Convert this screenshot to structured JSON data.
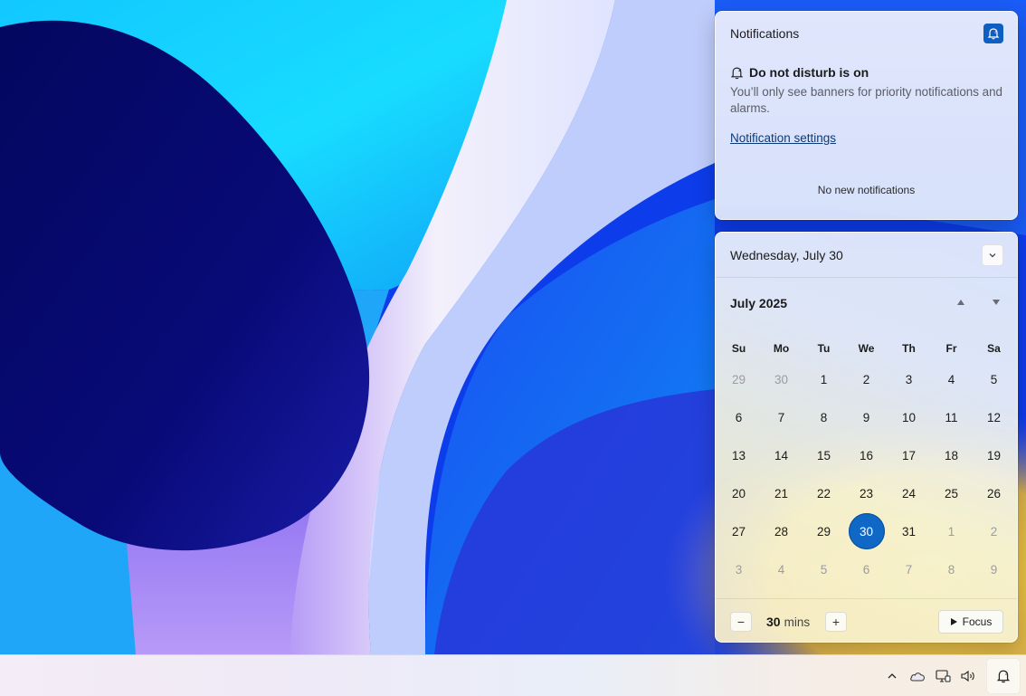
{
  "notifications": {
    "title": "Notifications",
    "dnd_heading": "Do not disturb is on",
    "dnd_description": "You’ll only see banners for priority notifications and alarms.",
    "settings_link": "Notification settings",
    "empty_state": "No new notifications"
  },
  "calendar": {
    "current_date": "Wednesday, July 30",
    "month_label": "July 2025",
    "weekdays": [
      "Su",
      "Mo",
      "Tu",
      "We",
      "Th",
      "Fr",
      "Sa"
    ],
    "weeks": [
      [
        "29",
        "30",
        "1",
        "2",
        "3",
        "4",
        "5"
      ],
      [
        "6",
        "7",
        "8",
        "9",
        "10",
        "11",
        "12"
      ],
      [
        "13",
        "14",
        "15",
        "16",
        "17",
        "18",
        "19"
      ],
      [
        "20",
        "21",
        "22",
        "23",
        "24",
        "25",
        "26"
      ],
      [
        "27",
        "28",
        "29",
        "30",
        "31",
        "1",
        "2"
      ],
      [
        "3",
        "4",
        "5",
        "6",
        "7",
        "8",
        "9"
      ]
    ],
    "today": "30"
  },
  "focus": {
    "value": "30",
    "unit": "mins",
    "minus_label": "−",
    "plus_label": "+",
    "button_label": "Focus"
  },
  "colors": {
    "accent": "#0f67c6",
    "muted_day": "#9b9ba2"
  },
  "taskbar": {
    "tray_icons": [
      "chevron-up-icon",
      "onedrive-cloud-icon",
      "network-icon",
      "volume-icon",
      "notification-bell-dnd-icon"
    ]
  }
}
